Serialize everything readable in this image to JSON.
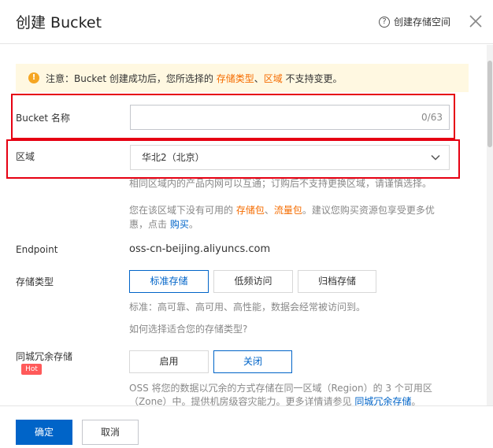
{
  "header": {
    "title": "创建 Bucket",
    "help_icon_glyph": "?",
    "help_link": "创建存储空间"
  },
  "notice": {
    "icon_glyph": "!",
    "prefix": "注意：Bucket 创建成功后，您所选择的 ",
    "storage_type": "存储类型",
    "separator": "、",
    "region": "区域",
    "suffix": " 不支持变更。"
  },
  "bucket_name": {
    "label": "Bucket 名称",
    "value": "",
    "counter": "0/63"
  },
  "region": {
    "label": "区域",
    "selected": "华北2（北京）",
    "hint": "相同区域内的产品内网可以互通；订购后不支持更换区域，请谨慎选择。",
    "hint2_prefix": "您在该区域下没有可用的 ",
    "hint2_pkg1": "存储包",
    "hint2_sep": "、",
    "hint2_pkg2": "流量包",
    "hint2_mid": "。建议您购买资源包享受更多优",
    "hint2_line2": "惠，点击 ",
    "hint2_buy": "购买",
    "hint2_end": "。"
  },
  "endpoint": {
    "label": "Endpoint",
    "value": "oss-cn-beijing.aliyuncs.com"
  },
  "storage_class": {
    "label": "存储类型",
    "options": [
      "标准存储",
      "低频访问",
      "归档存储"
    ],
    "selected_index": 0,
    "desc": "标准：高可靠、高可用、高性能，数据会经常被访问到。",
    "link": "如何选择适合您的存储类型?"
  },
  "zrs": {
    "label": "同城冗余存储",
    "badge": "Hot",
    "options": [
      "启用",
      "关闭"
    ],
    "selected_index": 1,
    "desc_line1": "OSS 将您的数据以冗余的方式存储在同一区域（Region）的 3 个可用区",
    "desc_line2": "（Zone）中。提供机房级容灾能力。更多详情请参见 ",
    "desc_link": "同城冗余存储",
    "desc_end": "。"
  },
  "footer": {
    "confirm": "确定",
    "cancel": "取消"
  },
  "colors": {
    "primary": "#0064c8",
    "accent_orange": "#f56c00",
    "highlight_red": "#e60012",
    "notice_bg": "#fff8e1",
    "hot_badge": "#ff5a5a"
  }
}
